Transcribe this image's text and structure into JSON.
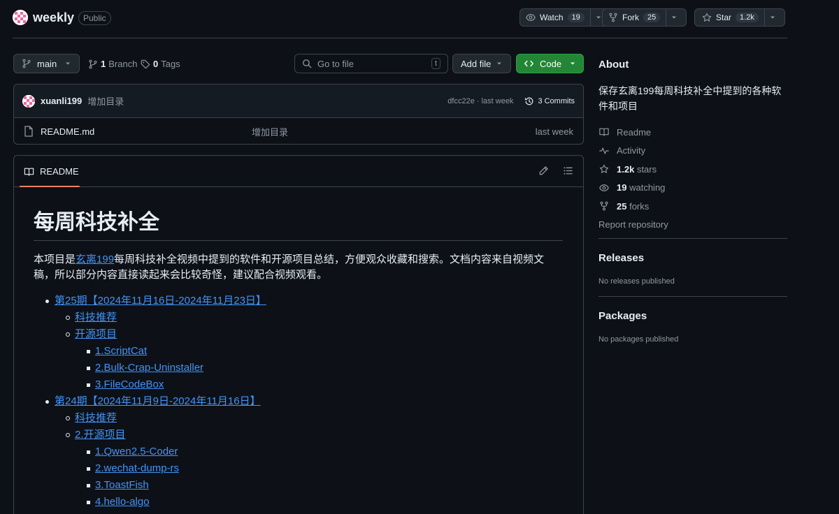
{
  "repo": {
    "name": "weekly",
    "visibility": "Public",
    "watch": {
      "label": "Watch",
      "count": "19"
    },
    "fork": {
      "label": "Fork",
      "count": "25"
    },
    "star": {
      "label": "Star",
      "count": "1.2k"
    }
  },
  "toolbar": {
    "branch": "main",
    "branches_count": "1",
    "branches_label": "Branch",
    "tags_count": "0",
    "tags_label": "Tags",
    "search_placeholder": "Go to file",
    "search_kbd": "t",
    "add_file": "Add file",
    "code": "Code"
  },
  "commit": {
    "author": "xuanli199",
    "message": "增加目录",
    "sha_time": "dfcc22e · last week",
    "commits_label": "3 Commits"
  },
  "files": [
    {
      "name": "README.md",
      "message": "增加目录",
      "date": "last week"
    }
  ],
  "readme": {
    "tab_label": "README",
    "title": "每周科技补全",
    "intro_prefix": "本项目是",
    "intro_link": "玄离199",
    "intro_suffix": "每周科技补全视频中提到的软件和开源项目总结，方便观众收藏和搜索。文档内容来自视频文稿，所以部分内容直接读起来会比较奇怪，建议配合视频观看。",
    "toc": [
      {
        "level": 1,
        "text": "第25期【2024年11月16日-2024年11月23日】"
      },
      {
        "level": 2,
        "text": "科技推荐"
      },
      {
        "level": 2,
        "text": "开源项目"
      },
      {
        "level": 3,
        "text": "1.ScriptCat"
      },
      {
        "level": 3,
        "text": "2.Bulk-Crap-Uninstaller"
      },
      {
        "level": 3,
        "text": "3.FileCodeBox"
      },
      {
        "level": 1,
        "text": "第24期【2024年11月9日-2024年11月16日】"
      },
      {
        "level": 2,
        "text": "科技推荐"
      },
      {
        "level": 2,
        "text": "2.开源项目"
      },
      {
        "level": 3,
        "text": "1.Qwen2.5-Coder"
      },
      {
        "level": 3,
        "text": "2.wechat-dump-rs"
      },
      {
        "level": 3,
        "text": "3.ToastFish"
      },
      {
        "level": 3,
        "text": "4.hello-algo"
      }
    ]
  },
  "about": {
    "heading": "About",
    "description": "保存玄离199每周科技补全中提到的各种软件和项目",
    "readme": "Readme",
    "activity": "Activity",
    "stars_count": "1.2k",
    "stars_label": "stars",
    "watching_count": "19",
    "watching_label": "watching",
    "forks_count": "25",
    "forks_label": "forks",
    "report": "Report repository"
  },
  "releases": {
    "heading": "Releases",
    "empty": "No releases published"
  },
  "packages": {
    "heading": "Packages",
    "empty": "No packages published"
  },
  "colors": {
    "accent_green": "#238636",
    "link": "#4493f8",
    "tab_underline": "#f78166"
  }
}
